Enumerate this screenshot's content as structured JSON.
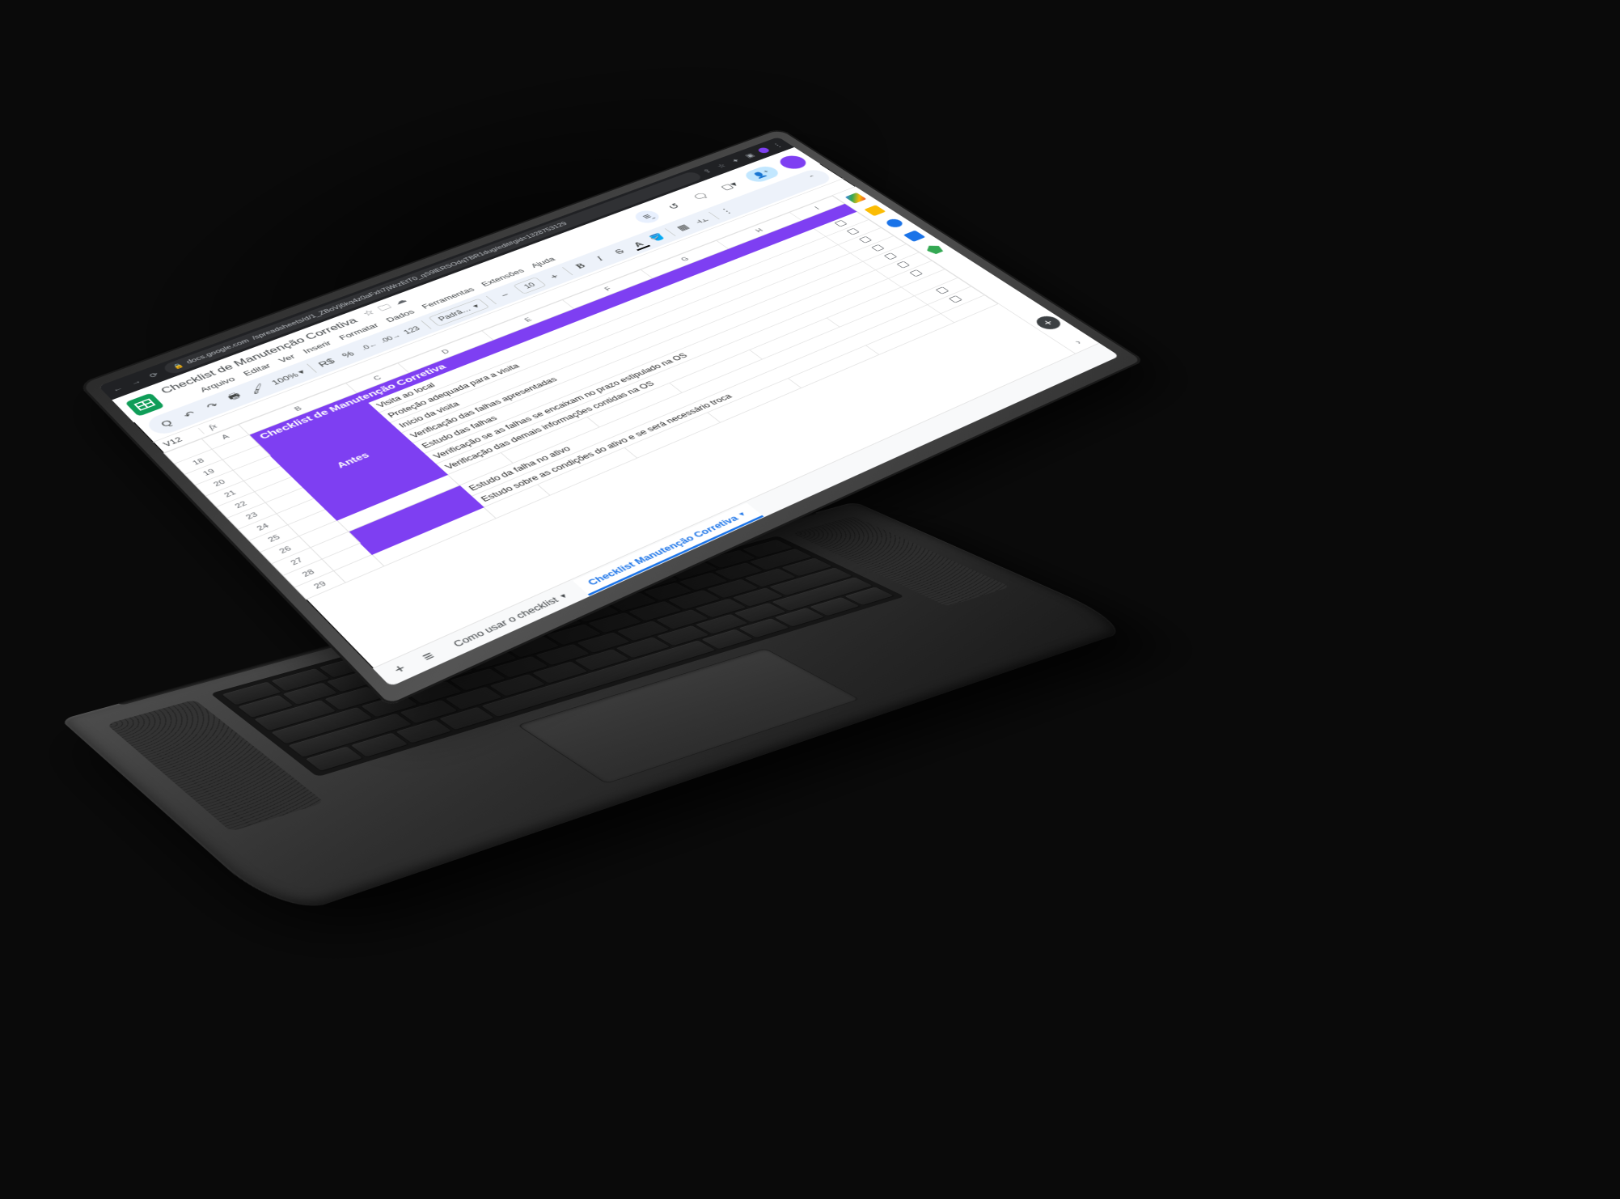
{
  "browser": {
    "url_host": "docs.google.com",
    "url_path": "/spreadsheets/d/1_ZBoVj6kq4z0aFxh7jWrzEtT0_qS9lERSOdqTBR1dug/edit#gid=1328753129"
  },
  "doc": {
    "title": "Checklist de Manutenção Corretiva"
  },
  "menus": [
    "Arquivo",
    "Editar",
    "Ver",
    "Inserir",
    "Formatar",
    "Dados",
    "Ferramentas",
    "Extensões",
    "Ajuda"
  ],
  "toolbar": {
    "zoom": "100%",
    "currency": "R$",
    "percent": "%",
    "dec_dec": ".0",
    "dec_inc": ".00",
    "num_fmt": "123",
    "font": "Padrã…",
    "font_size": "10",
    "minus": "−",
    "plus": "+"
  },
  "formula": {
    "name_box": "V12",
    "fx": "fx"
  },
  "columns": [
    "",
    "A",
    "B",
    "C",
    "D",
    "E",
    "F",
    "G",
    "H",
    "I"
  ],
  "row_start": 18,
  "row_count": 12,
  "sheet": {
    "title": "Checklist de Manutenção Corretiva",
    "section1": "Antes",
    "items1": [
      "Visita ao local",
      "Proteção adequada para a visita",
      "Início da visita",
      "Verificação das falhas apresentadas",
      "Estudo das falhas",
      "Verificação se as falhas se encaixam no prazo estipulado na OS",
      "Verificação das demais informações contidas na OS"
    ],
    "items2": [
      "Estudo da falha no ativo",
      "Estudo sobre as condições do ativo e se será necessário troca"
    ]
  },
  "tabs": {
    "add": "+",
    "menu": "≡",
    "tab1": "Como usar o checklist",
    "tab2": "Checklist Manutenção Corretiva"
  }
}
